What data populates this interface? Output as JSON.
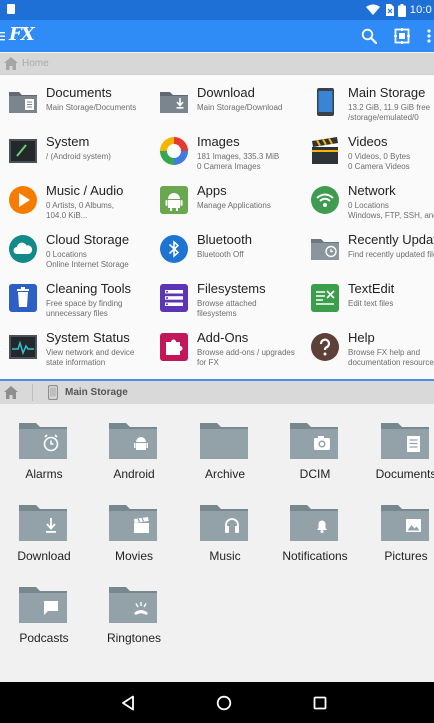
{
  "status_bar": {
    "time": "10:0"
  },
  "app_bar": {
    "logo": "FX"
  },
  "crumb_top": {
    "label": "Home"
  },
  "launcher": {
    "tiles": [
      {
        "title": "Documents",
        "sub1": "Main Storage/Documents",
        "sub2": "",
        "icon": "documents-icon"
      },
      {
        "title": "Download",
        "sub1": "Main Storage/Download",
        "sub2": "",
        "icon": "download-icon"
      },
      {
        "title": "Main Storage",
        "sub1": "13.2 GiB, 11.9 GiB free",
        "sub2": "/storage/emulated/0",
        "icon": "phone-icon"
      },
      {
        "title": "System",
        "sub1": "/ (Android system)",
        "sub2": "",
        "icon": "terminal-icon"
      },
      {
        "title": "Images",
        "sub1": "181 Images, 335.3 MiB",
        "sub2": "0 Camera Images",
        "icon": "images-icon"
      },
      {
        "title": "Videos",
        "sub1": "0 Videos, 0 Bytes",
        "sub2": "0 Camera Videos",
        "icon": "clapper-icon"
      },
      {
        "title": "Music / Audio",
        "sub1": "0 Artists, 0 Albums,",
        "sub2": "104.0 KiB...",
        "icon": "play-icon"
      },
      {
        "title": "Apps",
        "sub1": "Manage Applications",
        "sub2": "",
        "icon": "android-icon"
      },
      {
        "title": "Network",
        "sub1": "0 Locations",
        "sub2": "Windows, FTP, SSH, and...",
        "icon": "wifi-icon"
      },
      {
        "title": "Cloud Storage",
        "sub1": "0 Locations",
        "sub2": "Online Internet Storage",
        "icon": "cloud-icon"
      },
      {
        "title": "Bluetooth",
        "sub1": "Bluetooth Off",
        "sub2": "",
        "icon": "bluetooth-icon"
      },
      {
        "title": "Recently Updated",
        "sub1": "Find recently updated files",
        "sub2": "",
        "icon": "clock-folder-icon"
      },
      {
        "title": "Cleaning Tools",
        "sub1": "Free space by finding",
        "sub2": "unnecessary files",
        "icon": "trash-icon"
      },
      {
        "title": "Filesystems",
        "sub1": "Browse attached",
        "sub2": "filesystems",
        "icon": "filesystems-icon"
      },
      {
        "title": "TextEdit",
        "sub1": "Edit text files",
        "sub2": "",
        "icon": "textedit-icon"
      },
      {
        "title": "System Status",
        "sub1": "View network and device",
        "sub2": "state information",
        "icon": "monitor-icon"
      },
      {
        "title": "Add-Ons",
        "sub1": "Browse add-ons / upgrades",
        "sub2": "for FX",
        "icon": "puzzle-icon"
      },
      {
        "title": "Help",
        "sub1": "Browse FX help and",
        "sub2": "documentation resources",
        "icon": "help-icon"
      }
    ]
  },
  "crumb_bottom": {
    "label": "Main Storage"
  },
  "folders": [
    {
      "label": "Alarms",
      "badge": "alarm-clock"
    },
    {
      "label": "Android",
      "badge": "android"
    },
    {
      "label": "Archive",
      "badge": ""
    },
    {
      "label": "DCIM",
      "badge": "camera"
    },
    {
      "label": "Documents",
      "badge": "document"
    },
    {
      "label": "Download",
      "badge": "download"
    },
    {
      "label": "Movies",
      "badge": "clapper"
    },
    {
      "label": "Music",
      "badge": "headphones"
    },
    {
      "label": "Notifications",
      "badge": "bell"
    },
    {
      "label": "Pictures",
      "badge": "picture"
    },
    {
      "label": "Podcasts",
      "badge": "speech-bubble"
    },
    {
      "label": "Ringtones",
      "badge": "ringtone"
    }
  ],
  "colors": {
    "status_bar": "#1e6fd6",
    "app_bar": "#2f8bf5",
    "folder": "#8f9ea6",
    "divider": "#4a8ee6"
  }
}
